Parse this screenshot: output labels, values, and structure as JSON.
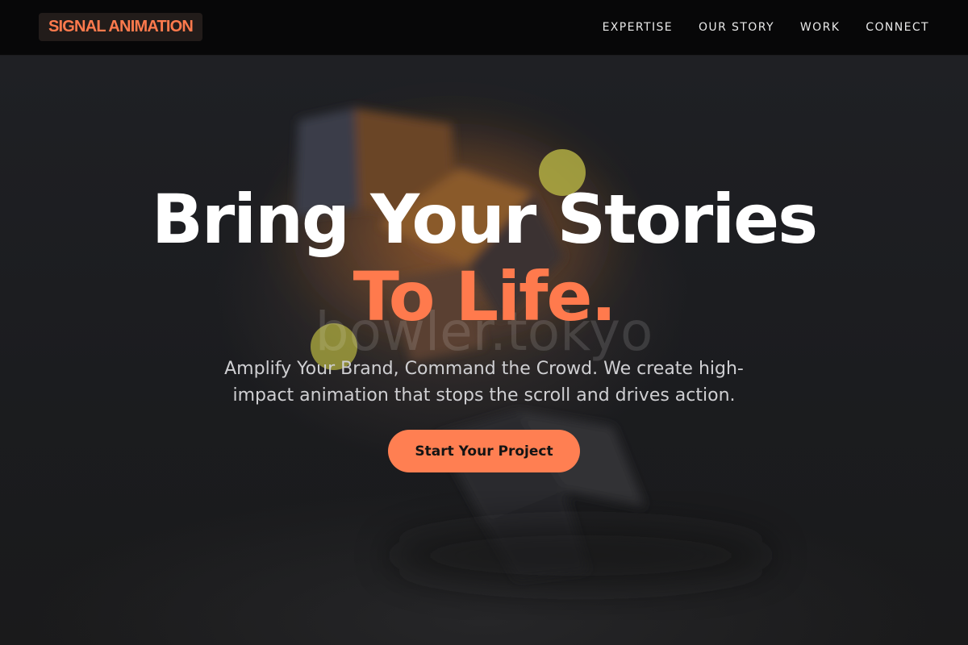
{
  "brand": {
    "name": "SIGNAL ANIMATION",
    "accent_color": "#ff7a4d"
  },
  "nav": {
    "items": [
      {
        "label": "EXPERTISE"
      },
      {
        "label": "OUR STORY"
      },
      {
        "label": "WORK"
      },
      {
        "label": "CONNECT"
      }
    ]
  },
  "hero": {
    "headline_line1": "Bring Your Stories",
    "headline_line2": "To Life.",
    "subtitle": "Amplify Your Brand, Command the Crowd. We create high-impact animation that stops the scroll and drives action.",
    "cta_label": "Start Your Project",
    "background_watermark": "bowler.tokyo"
  },
  "colors": {
    "header_bg": "#070708",
    "hero_bg": "#1d1d1f",
    "headline": "#ffffff",
    "cta_bg": "#ff7f52",
    "cta_text": "#141414"
  }
}
